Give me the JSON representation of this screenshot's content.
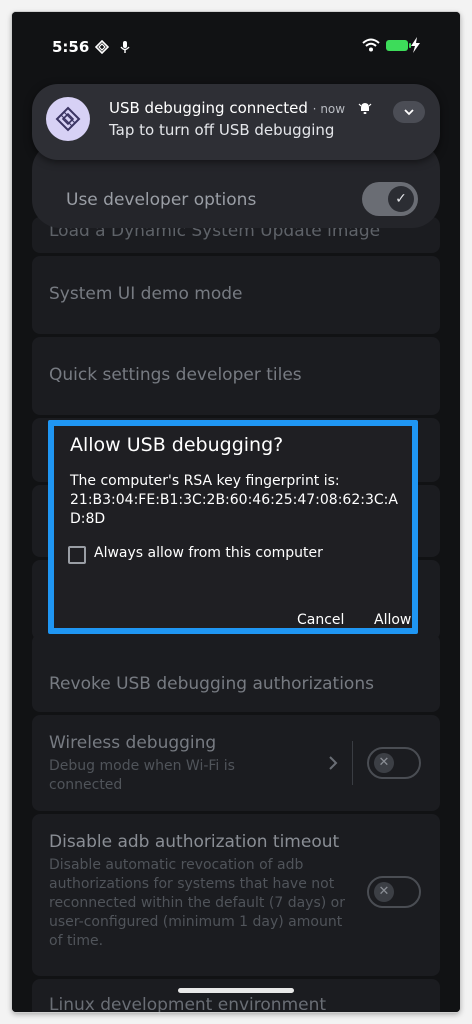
{
  "status_bar": {
    "time": "5:56"
  },
  "notification": {
    "title": "USB debugging connected",
    "time": "now",
    "body": "Tap to turn off USB debugging"
  },
  "developer_options": {
    "label": "Use developer options",
    "enabled": true
  },
  "settings": {
    "partial_item": "Load a Dynamic System Update image",
    "system_ui_demo": "System UI demo mode",
    "quick_settings_tiles": "Quick settings developer tiles",
    "revoke_usb": "Revoke USB debugging authorizations",
    "wireless_debugging": {
      "title": "Wireless debugging",
      "description": "Debug mode when Wi-Fi is connected",
      "enabled": false
    },
    "disable_adb_timeout": {
      "title": "Disable adb authorization timeout",
      "description": "Disable automatic revocation of adb authorizations for systems that have not reconnected within the default (7 days) or user-configured (minimum 1 day) amount of time.",
      "enabled": false
    },
    "linux_dev": "Linux development environment"
  },
  "dialog": {
    "title": "Allow USB debugging?",
    "message_line1": "The computer's RSA key fingerprint is:",
    "fingerprint": "21:B3:04:FE:B1:3C:2B:60:46:25:47:08:62:3C:AD:8D",
    "checkbox_label": "Always allow from this computer",
    "cancel": "Cancel",
    "allow": "Allow"
  },
  "colors": {
    "highlight": "#1f96f3",
    "battery": "#3ddc5a"
  }
}
